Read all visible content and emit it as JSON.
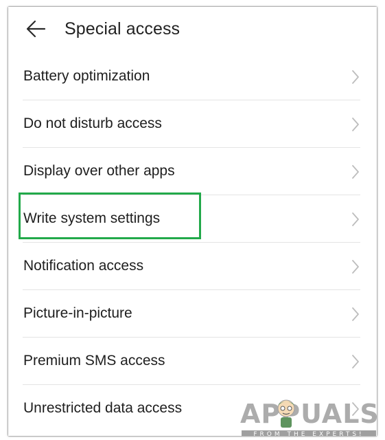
{
  "header": {
    "title": "Special access",
    "back_icon": "arrow-left-icon"
  },
  "list": {
    "items": [
      {
        "label": "Battery optimization",
        "icon": "chevron-right-icon"
      },
      {
        "label": "Do not disturb access",
        "icon": "chevron-right-icon"
      },
      {
        "label": "Display over other apps",
        "icon": "chevron-right-icon"
      },
      {
        "label": "Write system settings",
        "icon": "chevron-right-icon",
        "highlighted": true
      },
      {
        "label": "Notification access",
        "icon": "chevron-right-icon"
      },
      {
        "label": "Picture-in-picture",
        "icon": "chevron-right-icon"
      },
      {
        "label": "Premium SMS access",
        "icon": "chevron-right-icon"
      },
      {
        "label": "Unrestricted data access",
        "icon": "chevron-right-icon"
      }
    ]
  },
  "highlight": {
    "color": "#22a94a"
  },
  "watermark": {
    "text": "APPUALS",
    "tagline": "FROM THE EXPERTS!"
  },
  "colors": {
    "text": "#1e1e1e",
    "chevron": "#bdbdbd",
    "divider": "#e4e4e4"
  }
}
